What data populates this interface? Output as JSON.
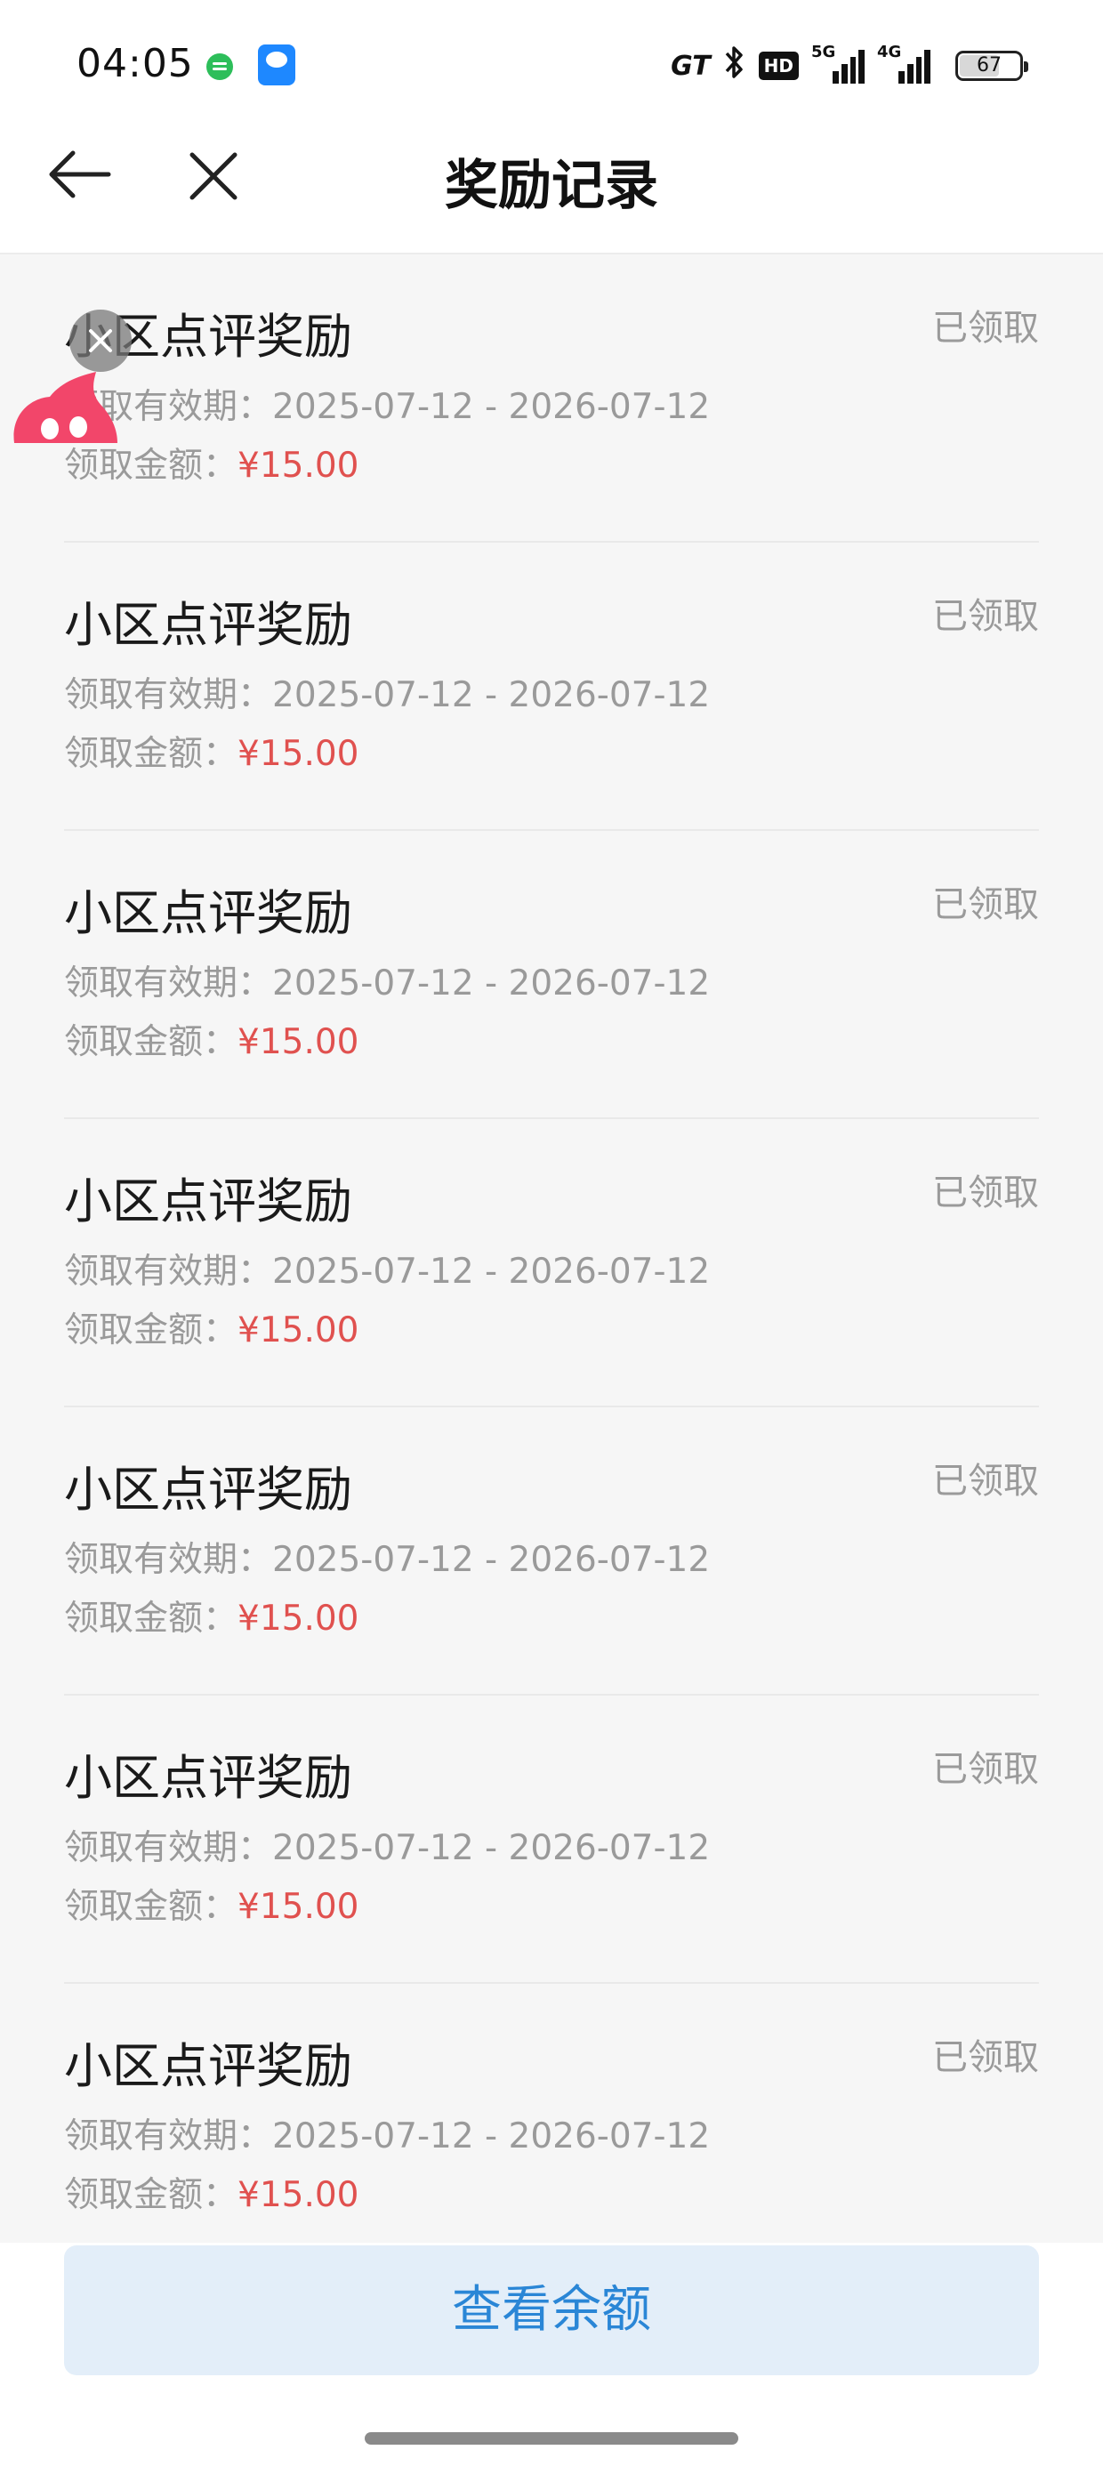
{
  "status_bar": {
    "time": "04:05",
    "carrier_mark": "GT",
    "hd_label": "HD",
    "signal_1": "5G",
    "signal_2": "4G",
    "battery": "67",
    "battery_level": 0.67,
    "icons": [
      "message-app-icon",
      "ai-app-icon",
      "bluetooth-icon",
      "signal-icon",
      "battery-icon"
    ]
  },
  "header": {
    "title": "奖励记录",
    "back_icon": "back-arrow-icon",
    "close_icon": "close-icon"
  },
  "records": [
    {
      "title": "小区点评奖励",
      "status": "已领取",
      "validity_label": "领取有效期：",
      "validity": "2025-07-12 - 2026-07-12",
      "amount_label": "领取金额：",
      "amount": "¥15.00"
    },
    {
      "title": "小区点评奖励",
      "status": "已领取",
      "validity_label": "领取有效期：",
      "validity": "2025-07-12 - 2026-07-12",
      "amount_label": "领取金额：",
      "amount": "¥15.00"
    },
    {
      "title": "小区点评奖励",
      "status": "已领取",
      "validity_label": "领取有效期：",
      "validity": "2025-07-12 - 2026-07-12",
      "amount_label": "领取金额：",
      "amount": "¥15.00"
    },
    {
      "title": "小区点评奖励",
      "status": "已领取",
      "validity_label": "领取有效期：",
      "validity": "2025-07-12 - 2026-07-12",
      "amount_label": "领取金额：",
      "amount": "¥15.00"
    },
    {
      "title": "小区点评奖励",
      "status": "已领取",
      "validity_label": "领取有效期：",
      "validity": "2025-07-12 - 2026-07-12",
      "amount_label": "领取金额：",
      "amount": "¥15.00"
    },
    {
      "title": "小区点评奖励",
      "status": "已领取",
      "validity_label": "领取有效期：",
      "validity": "2025-07-12 - 2026-07-12",
      "amount_label": "领取金额：",
      "amount": "¥15.00"
    },
    {
      "title": "小区点评奖励",
      "status": "已领取",
      "validity_label": "领取有效期：",
      "validity": "2025-07-12 - 2026-07-12",
      "amount_label": "领取金额：",
      "amount": "¥15.00"
    }
  ],
  "bottom": {
    "button_label": "查看余额"
  },
  "colors": {
    "amount": "#e0514f",
    "button_bg": "#e3eef9",
    "button_text": "#2a86d6",
    "list_bg": "#f6f6f6"
  }
}
